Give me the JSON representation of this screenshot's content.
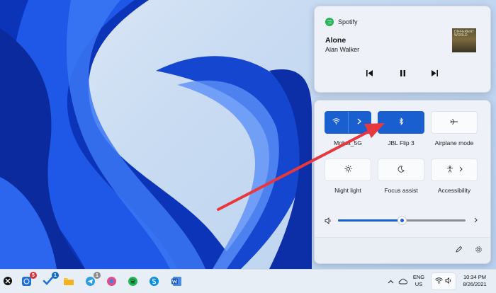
{
  "media": {
    "app_name": "Spotify",
    "track_title": "Alone",
    "artist": "Alan Walker",
    "album_art_text": "DIFFERENT WORLD",
    "controls": {
      "prev_icon": "previous-track-icon",
      "play_icon": "pause-icon",
      "next_icon": "next-track-icon"
    }
  },
  "quick_settings": {
    "tiles": [
      {
        "label": "Mohta_5G",
        "icon": "wifi-icon",
        "state": "on",
        "has_expand": true
      },
      {
        "label": "JBL Flip 3",
        "icon": "bluetooth-icon",
        "state": "on"
      },
      {
        "label": "Airplane mode",
        "icon": "airplane-icon",
        "state": "off"
      },
      {
        "label": "Night light",
        "icon": "brightness-icon",
        "state": "off"
      },
      {
        "label": "Focus assist",
        "icon": "moon-icon",
        "state": "off"
      },
      {
        "label": "Accessibility",
        "icon": "accessibility-icon",
        "state": "off",
        "has_expand": true
      }
    ],
    "volume": {
      "level": 0.5,
      "icon": "speaker-icon"
    },
    "footer_icons": [
      "edit-icon",
      "settings-icon"
    ]
  },
  "taskbar": {
    "apps": [
      {
        "name": "start-icon"
      },
      {
        "name": "whatsapp-icon",
        "badge": "5",
        "badge_color": "#d13438"
      },
      {
        "name": "tasks-icon",
        "badge": "1",
        "badge_color": "#0f6cbd"
      },
      {
        "name": "file-explorer-icon"
      },
      {
        "name": "telegram-icon",
        "badge": "1",
        "badge_color": "#8a8a8a"
      },
      {
        "name": "browser-icon"
      },
      {
        "name": "spotify-icon"
      },
      {
        "name": "skype-icon"
      },
      {
        "name": "word-icon"
      }
    ],
    "tray": {
      "language": "ENG",
      "region": "US",
      "time": "10:34 PM",
      "date": "8/26/2021"
    }
  },
  "colors": {
    "accent": "#1a5fd0",
    "annotation_arrow": "#e8383d"
  }
}
